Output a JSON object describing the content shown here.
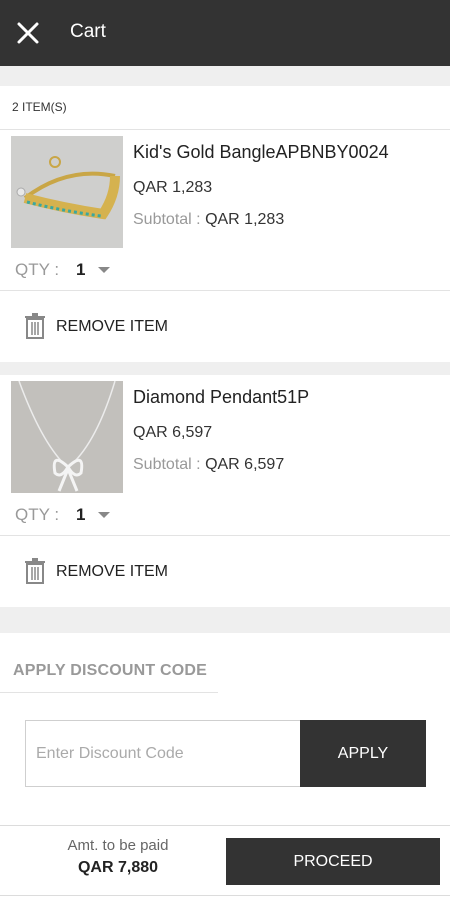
{
  "appbar": {
    "title": "Cart",
    "close_icon": "close-icon"
  },
  "cart": {
    "count_label": "2 ITEM(S)"
  },
  "items": [
    {
      "name": "Kid's Gold BangleAPBNBY0024",
      "price": "QAR 1,283",
      "subtotal_label": "Subtotal :",
      "subtotal_value": "QAR 1,283",
      "qty_label": "QTY :",
      "qty_value": "1",
      "remove_label": "REMOVE ITEM",
      "image_icon": "bangle-image"
    },
    {
      "name": "Diamond Pendant51P",
      "price": "QAR 6,597",
      "subtotal_label": "Subtotal :",
      "subtotal_value": "QAR 6,597",
      "qty_label": "QTY :",
      "qty_value": "1",
      "remove_label": "REMOVE ITEM",
      "image_icon": "pendant-image"
    }
  ],
  "discount": {
    "heading": "APPLY DISCOUNT CODE",
    "placeholder": "Enter Discount Code",
    "apply_label": "APPLY"
  },
  "footer": {
    "amount_label": "Amt. to be paid",
    "amount_value": "QAR 7,880",
    "proceed_label": "PROCEED"
  },
  "colors": {
    "dark": "#333333",
    "muted": "#999999",
    "background": "#efefef"
  }
}
